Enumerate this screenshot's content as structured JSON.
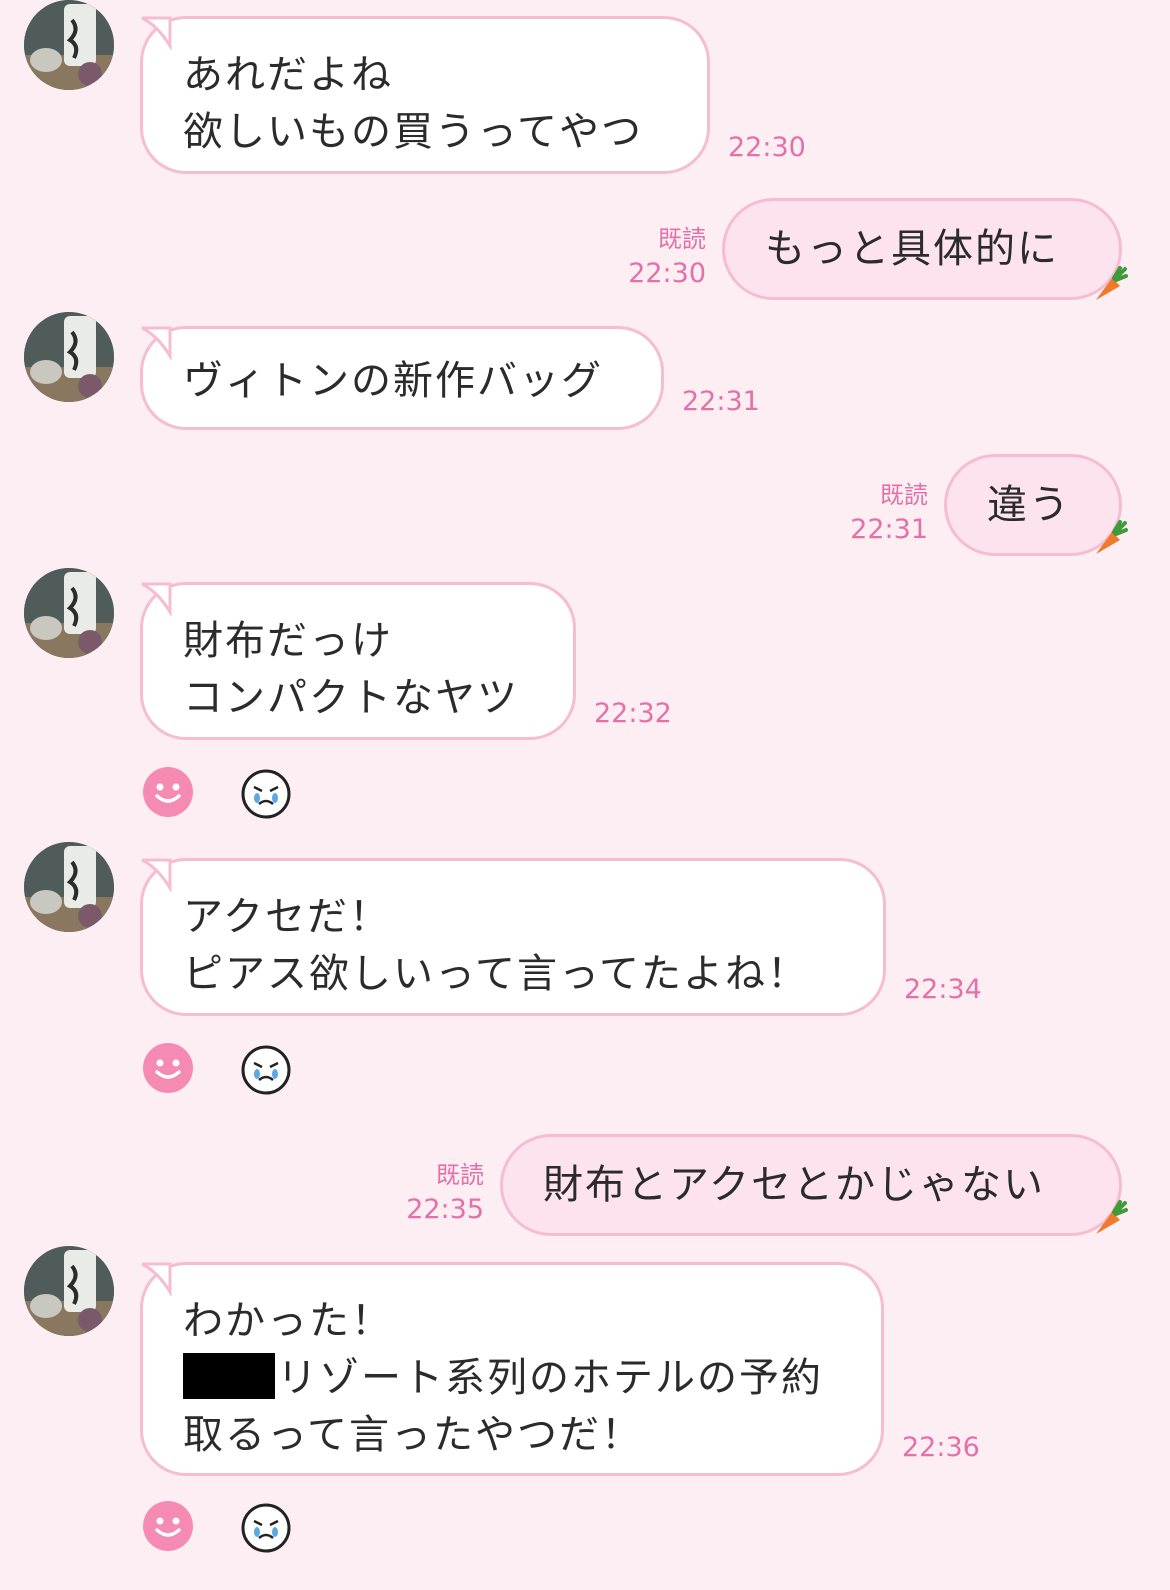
{
  "messages": [
    {
      "side": "in",
      "lines": [
        "あれだよね",
        "欲しいもの買うってやつ"
      ],
      "time": "22:30"
    },
    {
      "side": "out",
      "text": "もっと具体的に",
      "read": "既読",
      "time": "22:30"
    },
    {
      "side": "in",
      "lines": [
        "ヴィトンの新作バッグ"
      ],
      "time": "22:31"
    },
    {
      "side": "out",
      "text": "違う",
      "read": "既読",
      "time": "22:31"
    },
    {
      "side": "in",
      "lines": [
        "財布だっけ",
        "コンパクトなヤツ"
      ],
      "time": "22:32"
    },
    {
      "side": "in",
      "lines": [
        "アクセだ！",
        "ピアス欲しいって言ってたよね！"
      ],
      "time": "22:34"
    },
    {
      "side": "out",
      "text": "財布とアクセとかじゃない",
      "read": "既読",
      "time": "22:35"
    },
    {
      "side": "in",
      "lines": [
        "わかった！",
        "リゾート系列のホテルの予約",
        "取るって言ったやつだ！"
      ],
      "time": "22:36"
    }
  ],
  "icons": {
    "avatar": "sake-bottle-avatar-icon",
    "react_add": "smiley-face-icon",
    "react_sad": "crying-face-icon",
    "out_decoration": "carrot-icon"
  },
  "colors": {
    "background": "#fdeef4",
    "bubble_border": "#f6bcd2",
    "outgoing_bubble": "#fde3ee",
    "accent_text": "#e371a6",
    "smiley": "#f58bb2"
  }
}
